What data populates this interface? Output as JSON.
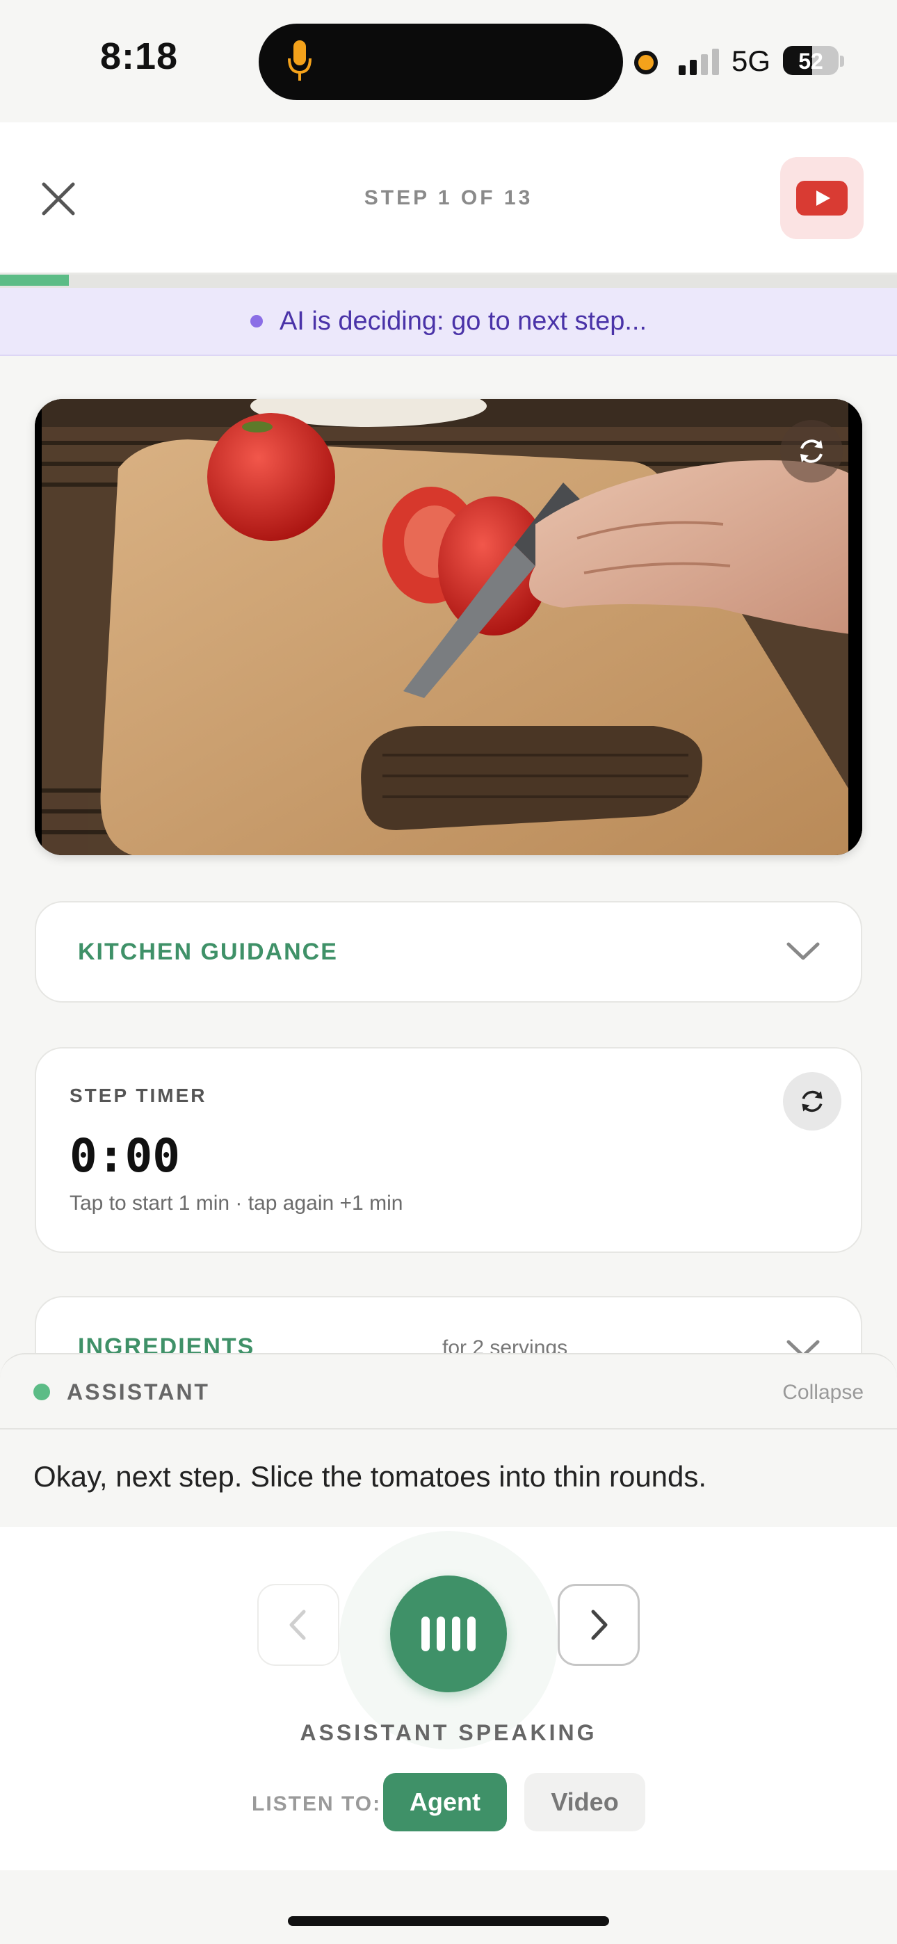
{
  "status_bar": {
    "time": "8:18",
    "network": "5G",
    "battery": "52",
    "battery_level": 0.52,
    "signal_bars_active": 2,
    "icons": [
      "microphone-icon",
      "recording-dot",
      "cellular-signal-icon",
      "battery-icon"
    ]
  },
  "header": {
    "close_icon": "close-icon",
    "step_label": "STEP 1 OF 13",
    "step_current": 1,
    "step_total": 13,
    "video_icon": "youtube-icon"
  },
  "progress": {
    "fraction": 0.077
  },
  "ai_banner": {
    "text": "AI is deciding: go to next step..."
  },
  "video": {
    "description_icon": "video-frame",
    "refresh_icon": "refresh-icon"
  },
  "guidance": {
    "title": "KITCHEN GUIDANCE",
    "chevron_icon": "chevron-down-icon"
  },
  "timer": {
    "label": "STEP TIMER",
    "value": "0:00",
    "hint": "Tap to start 1 min · tap again +1 min",
    "reset_icon": "refresh-icon"
  },
  "ingredients": {
    "title": "INGREDIENTS",
    "servings": "for 2 servings",
    "chevron_icon": "chevron-down-icon"
  },
  "assistant": {
    "label": "ASSISTANT",
    "collapse": "Collapse",
    "message": "Okay, next step. Slice the tomatoes into thin rounds."
  },
  "controls": {
    "prev_icon": "chevron-left-icon",
    "next_icon": "chevron-right-icon",
    "mic_icon": "audio-bars-icon",
    "status": "ASSISTANT SPEAKING",
    "listen_label": "LISTEN TO:",
    "options": [
      "Agent",
      "Video"
    ],
    "selected": "Agent"
  },
  "colors": {
    "accent_green": "#3f9168",
    "progress_green": "#5cbc86",
    "banner_bg": "#ece8fb",
    "banner_text": "#4a33a8",
    "youtube_red": "#d93b33"
  }
}
